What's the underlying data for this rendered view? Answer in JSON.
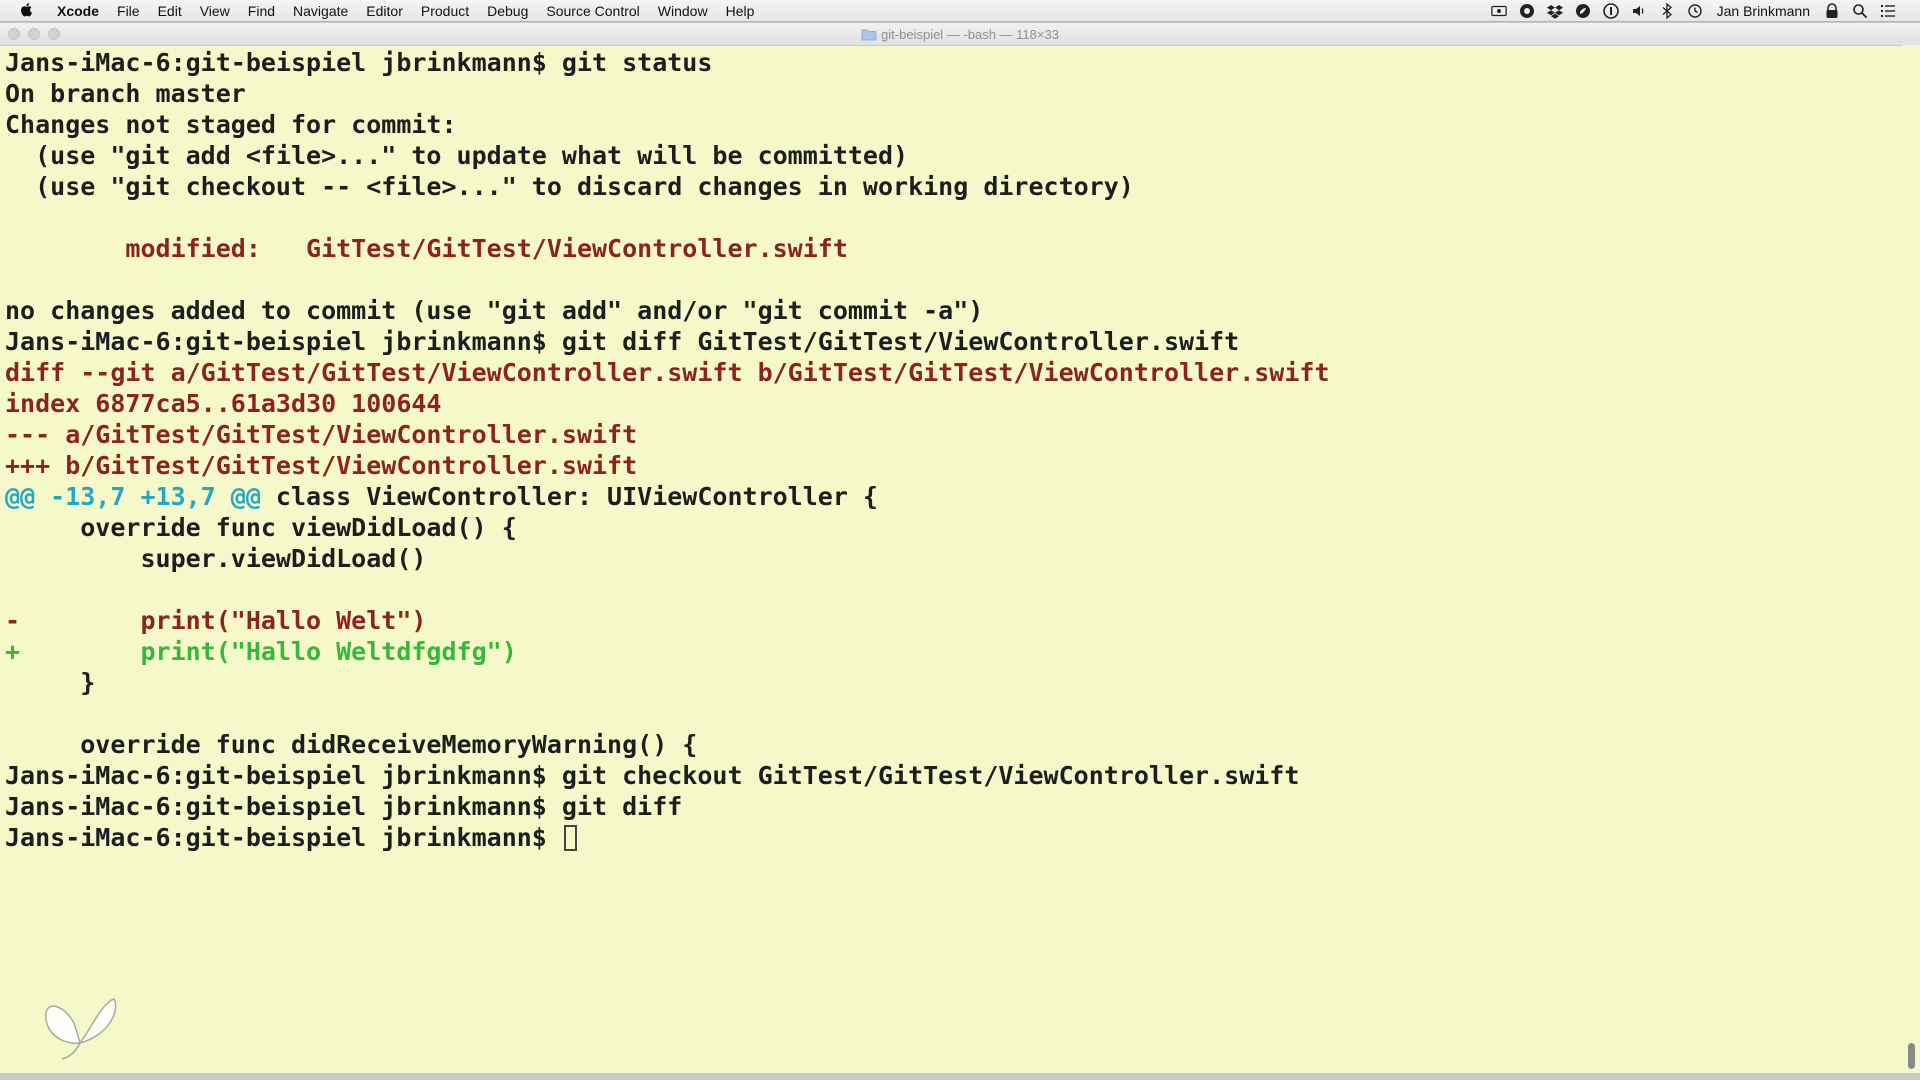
{
  "menubar": {
    "app_name": "Xcode",
    "items": [
      "File",
      "Edit",
      "View",
      "Find",
      "Navigate",
      "Editor",
      "Product",
      "Debug",
      "Source Control",
      "Window",
      "Help"
    ],
    "user_name": "Jan Brinkmann",
    "status_icons": [
      "screen-record-icon",
      "camera-shutter-icon",
      "dropbox-icon",
      "evernote-icon",
      "one-password-icon",
      "volume-icon",
      "bluetooth-icon",
      "time-machine-icon"
    ]
  },
  "window": {
    "title": "git-beispiel — -bash — 118×33",
    "background": "#f5f8c8"
  },
  "colors": {
    "default": "#1e1e1e",
    "red": "#8c2323",
    "cyan": "#23a7c2",
    "green": "#36b83a"
  },
  "terminal": {
    "lines": [
      [
        {
          "t": "Jans-iMac-6:git-beispiel jbrinkmann$ git status",
          "c": "default"
        }
      ],
      [
        {
          "t": "On branch master",
          "c": "default"
        }
      ],
      [
        {
          "t": "Changes not staged for commit:",
          "c": "default"
        }
      ],
      [
        {
          "t": "  (use \"git add <file>...\" to update what will be committed)",
          "c": "default"
        }
      ],
      [
        {
          "t": "  (use \"git checkout -- <file>...\" to discard changes in working directory)",
          "c": "default"
        }
      ],
      [
        {
          "t": "",
          "c": "default"
        }
      ],
      [
        {
          "t": "        modified:   GitTest/GitTest/ViewController.swift",
          "c": "red"
        }
      ],
      [
        {
          "t": "",
          "c": "default"
        }
      ],
      [
        {
          "t": "no changes added to commit (use \"git add\" and/or \"git commit -a\")",
          "c": "default"
        }
      ],
      [
        {
          "t": "Jans-iMac-6:git-beispiel jbrinkmann$ git diff GitTest/GitTest/ViewController.swift",
          "c": "default"
        }
      ],
      [
        {
          "t": "diff --git a/GitTest/GitTest/ViewController.swift b/GitTest/GitTest/ViewController.swift",
          "c": "red"
        }
      ],
      [
        {
          "t": "index 6877ca5..61a3d30 100644",
          "c": "red"
        }
      ],
      [
        {
          "t": "--- a/GitTest/GitTest/ViewController.swift",
          "c": "red"
        }
      ],
      [
        {
          "t": "+++ b/GitTest/GitTest/ViewController.swift",
          "c": "red"
        }
      ],
      [
        {
          "t": "@@ -13,7 +13,7 @@",
          "c": "cyan"
        },
        {
          "t": " class ViewController: UIViewController {",
          "c": "default"
        }
      ],
      [
        {
          "t": "     override func viewDidLoad() {",
          "c": "default"
        }
      ],
      [
        {
          "t": "         super.viewDidLoad()",
          "c": "default"
        }
      ],
      [
        {
          "t": "",
          "c": "default"
        }
      ],
      [
        {
          "t": "-        print(\"Hallo Welt\")",
          "c": "red"
        }
      ],
      [
        {
          "t": "+        print(\"Hallo Weltdfgdfg\")",
          "c": "green"
        }
      ],
      [
        {
          "t": "     }",
          "c": "default"
        }
      ],
      [
        {
          "t": "",
          "c": "default"
        }
      ],
      [
        {
          "t": "     override func didReceiveMemoryWarning() {",
          "c": "default"
        }
      ],
      [
        {
          "t": "Jans-iMac-6:git-beispiel jbrinkmann$ git checkout GitTest/GitTest/ViewController.swift",
          "c": "default"
        }
      ],
      [
        {
          "t": "Jans-iMac-6:git-beispiel jbrinkmann$ git diff",
          "c": "default"
        }
      ],
      [
        {
          "t": "Jans-iMac-6:git-beispiel jbrinkmann$ ",
          "c": "default"
        }
      ]
    ]
  }
}
